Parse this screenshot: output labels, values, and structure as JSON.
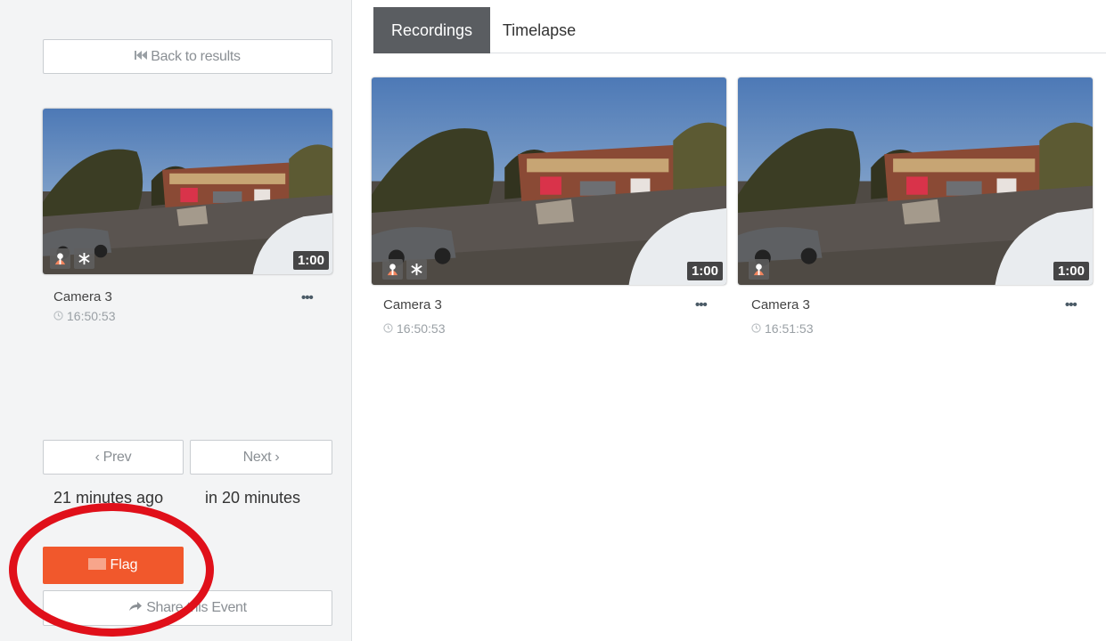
{
  "sidebar": {
    "back_label": "Back to results",
    "thumb": {
      "duration": "1:00",
      "camera": "Camera 3",
      "time": "16:50:53",
      "more": "•••"
    },
    "prev_label": "Prev",
    "next_label": "Next",
    "prev_relative": "21 minutes ago",
    "next_relative": "in 20 minutes",
    "flag_label": "Flag",
    "share_label": "Share this Event"
  },
  "tabs": [
    {
      "label": "Recordings",
      "active": true
    },
    {
      "label": "Timelapse",
      "active": false
    }
  ],
  "recordings": [
    {
      "camera": "Camera 3",
      "time": "16:50:53",
      "duration": "1:00",
      "more": "•••",
      "badges": [
        "person-icon",
        "snowflake-icon"
      ]
    },
    {
      "camera": "Camera 3",
      "time": "16:51:53",
      "duration": "1:00",
      "more": "•••",
      "badges": [
        "person-icon"
      ]
    }
  ],
  "colors": {
    "flag": "#f1582c",
    "highlight_circle": "#e0101a",
    "active_tab": "#5a5d61"
  }
}
